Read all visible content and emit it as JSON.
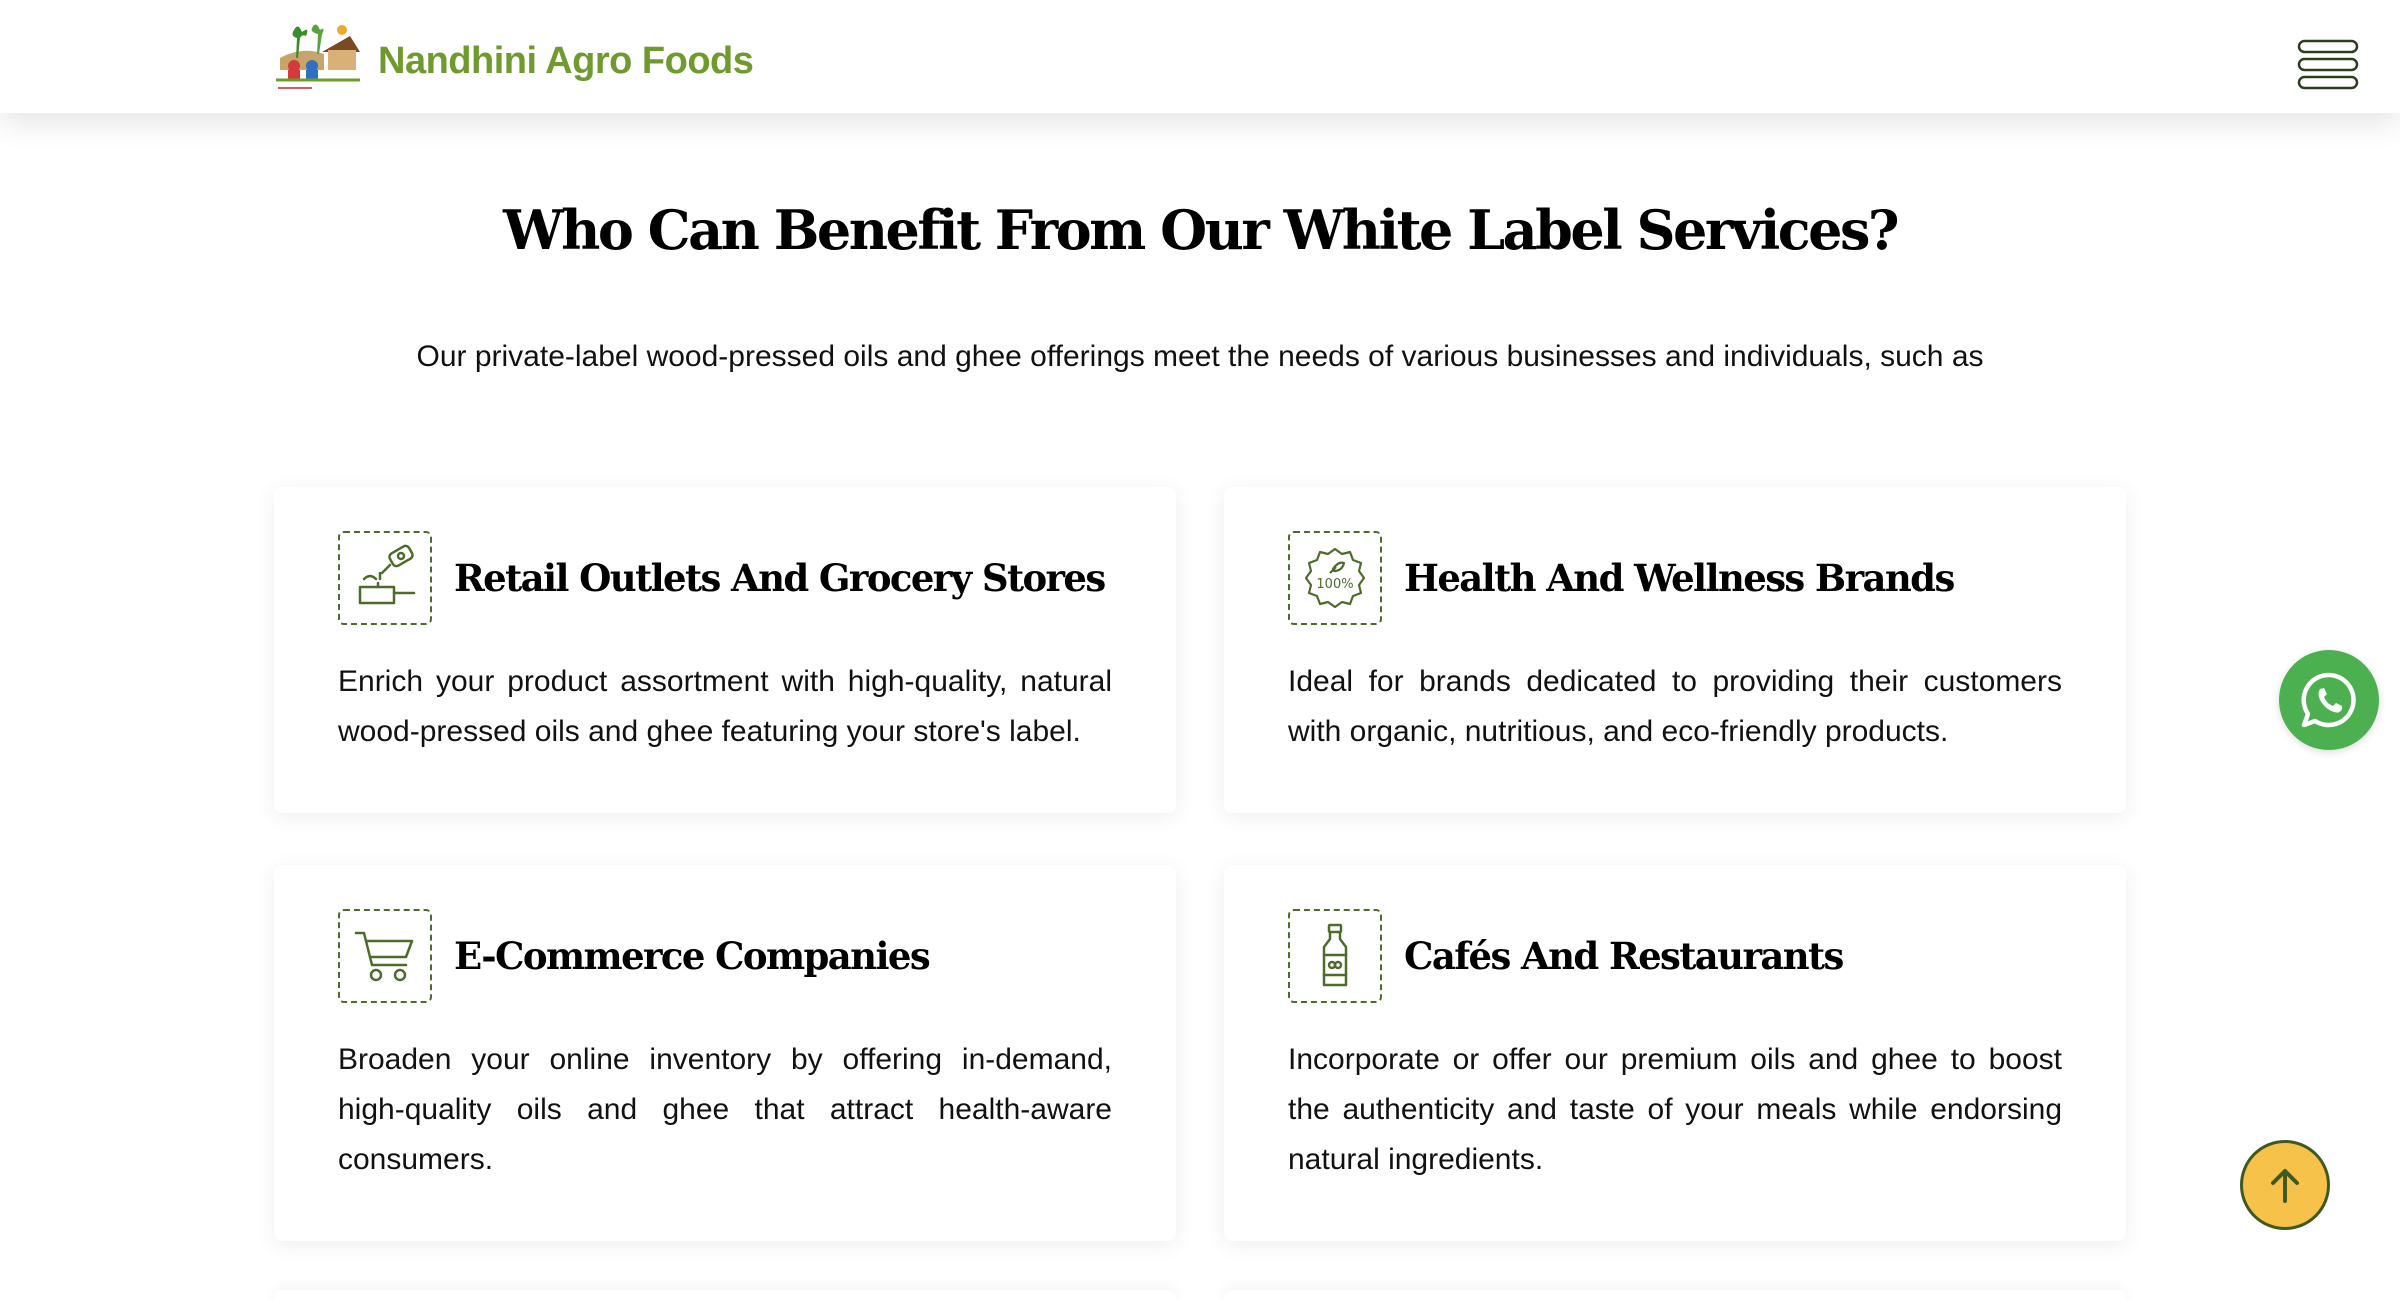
{
  "header": {
    "brand_name": "Nandhini Agro Foods",
    "logo_icon": "farm-logo-icon",
    "menu_icon": "hamburger-menu-icon"
  },
  "section": {
    "title": "Who Can Benefit From Our White Label Services?",
    "subtitle": "Our private-label wood-pressed oils and ghee offerings meet the needs of various businesses and individuals, such as"
  },
  "cards": [
    {
      "icon": "oil-pour-icon",
      "title": "Retail Outlets And Grocery Stores",
      "text": "Enrich your product assortment with high-quality, natural wood-pressed oils and ghee featuring your store's label."
    },
    {
      "icon": "organic-100-badge-icon",
      "title": "Health And Wellness Brands",
      "text": "Ideal for brands dedicated to providing their customers with organic, nutritious, and eco-friendly products."
    },
    {
      "icon": "shopping-cart-icon",
      "title": "E-Commerce Companies",
      "text": "Broaden your online inventory by offering in-demand, high-quality oils and ghee that attract health-aware consumers."
    },
    {
      "icon": "oil-bottle-icon",
      "title": "Cafés And Restaurants",
      "text": "Incorporate or offer our premium oils and ghee to boost the authenticity and taste of your meals while endorsing natural ingredients."
    }
  ],
  "floating": {
    "whatsapp_icon": "whatsapp-icon",
    "scroll_top_icon": "arrow-up-icon"
  },
  "colors": {
    "brand_green": "#6f9a2e",
    "icon_green": "#4f6b2c",
    "whatsapp_green": "#4caf50",
    "scroll_top_yellow": "#f7c24a"
  }
}
